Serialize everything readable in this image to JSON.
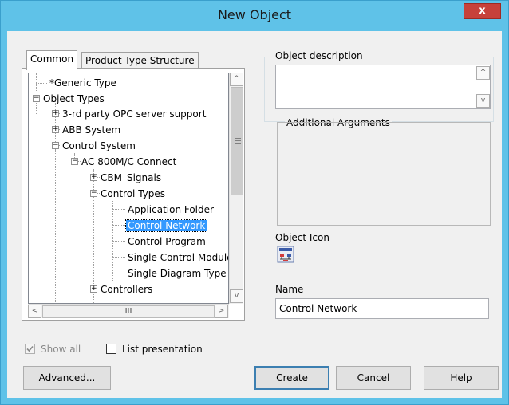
{
  "window": {
    "title": "New Object",
    "close_glyph": "x"
  },
  "tabs": [
    {
      "label": "Common",
      "active": true
    },
    {
      "label": "Product Type Structure",
      "active": false
    }
  ],
  "tree": {
    "nodes": [
      {
        "label": "*Generic Type",
        "expander": ""
      },
      {
        "label": "Object Types",
        "expander": "−"
      },
      {
        "label": "3-rd party OPC server support",
        "expander": "+"
      },
      {
        "label": "ABB System",
        "expander": "+"
      },
      {
        "label": "Control System",
        "expander": "−"
      },
      {
        "label": "AC 800M/C Connect",
        "expander": "−"
      },
      {
        "label": "CBM_Signals",
        "expander": "+"
      },
      {
        "label": "Control Types",
        "expander": "−"
      },
      {
        "label": "Application Folder",
        "expander": ""
      },
      {
        "label": "Control Network",
        "expander": "",
        "selected": true
      },
      {
        "label": "Control Program",
        "expander": ""
      },
      {
        "label": "Single Control Module",
        "expander": ""
      },
      {
        "label": "Single Diagram Type",
        "expander": ""
      },
      {
        "label": "Controllers",
        "expander": "+"
      }
    ],
    "scroll": {
      "up": "^",
      "down": "v",
      "left": "<",
      "right": ">",
      "hthumb": "III"
    }
  },
  "object_description": {
    "label": "Object description",
    "value": ""
  },
  "additional_arguments": {
    "label": "Additional Arguments"
  },
  "object_icon": {
    "label": "Object Icon",
    "icon": "network-icon"
  },
  "name": {
    "label": "Name",
    "value": "Control Network"
  },
  "options": {
    "show_all": {
      "label": "Show all",
      "checked": true,
      "enabled": false
    },
    "list_presentation": {
      "label": "List presentation",
      "checked": false
    }
  },
  "buttons": {
    "advanced": "Advanced...",
    "create": "Create",
    "cancel": "Cancel",
    "help": "Help"
  },
  "colors": {
    "titlebar": "#5fc2e8",
    "close": "#c7413a",
    "selection": "#3399ff",
    "dialog": "#f0f0f0"
  }
}
